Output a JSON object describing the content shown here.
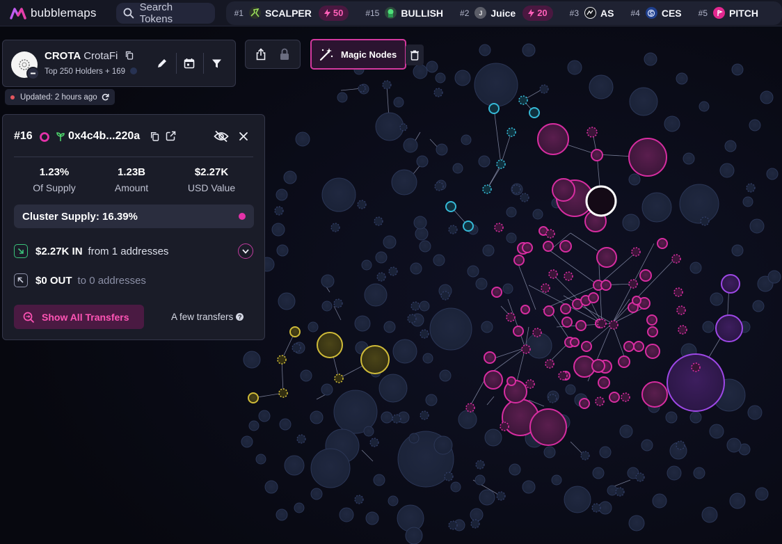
{
  "app": {
    "name": "bubblemaps"
  },
  "colors": {
    "accent": "#e432a9",
    "background": "#07080f",
    "panel": "#1a1c28",
    "cyan": "#38c2e0",
    "yellow": "#d9c43a",
    "purple": "#a54bf0"
  },
  "search": {
    "placeholder": "Search Tokens"
  },
  "trending": [
    {
      "rank": "#1",
      "symbol": "SCALPER",
      "boost": "50",
      "icon": "scalper-icon"
    },
    {
      "rank": "#15",
      "symbol": "BULLISH",
      "icon": "bullish-icon"
    },
    {
      "rank": "#2",
      "symbol": "Juice",
      "boost": "20",
      "icon": "juice-icon",
      "icon_text": "J"
    },
    {
      "rank": "#3",
      "symbol": "AS",
      "icon": "as-icon"
    },
    {
      "rank": "#4",
      "symbol": "CES",
      "icon": "ces-icon"
    },
    {
      "rank": "#5",
      "symbol": "PITCH",
      "icon": "pitch-icon"
    }
  ],
  "token": {
    "symbol": "CROTA",
    "name": "CrotaFi",
    "subtitle": "Top 250 Holders + 169",
    "updated": "Updated: 2 hours ago"
  },
  "toolbar": {
    "magic_nodes": "Magic Nodes"
  },
  "address": {
    "rank": "#16",
    "short": "0x4c4b...220a",
    "stats": [
      {
        "value": "1.23%",
        "label": "Of Supply"
      },
      {
        "value": "1.23B",
        "label": "Amount"
      },
      {
        "value": "$2.27K",
        "label": "USD Value"
      }
    ],
    "cluster_supply": "Cluster Supply: 16.39%",
    "in_amount": "$2.27K IN",
    "in_desc": "from 1 addresses",
    "out_amount": "$0 OUT",
    "out_desc": "to 0 addresses",
    "show_transfers": "Show All Transfers",
    "few_transfers": "A few transfers"
  }
}
